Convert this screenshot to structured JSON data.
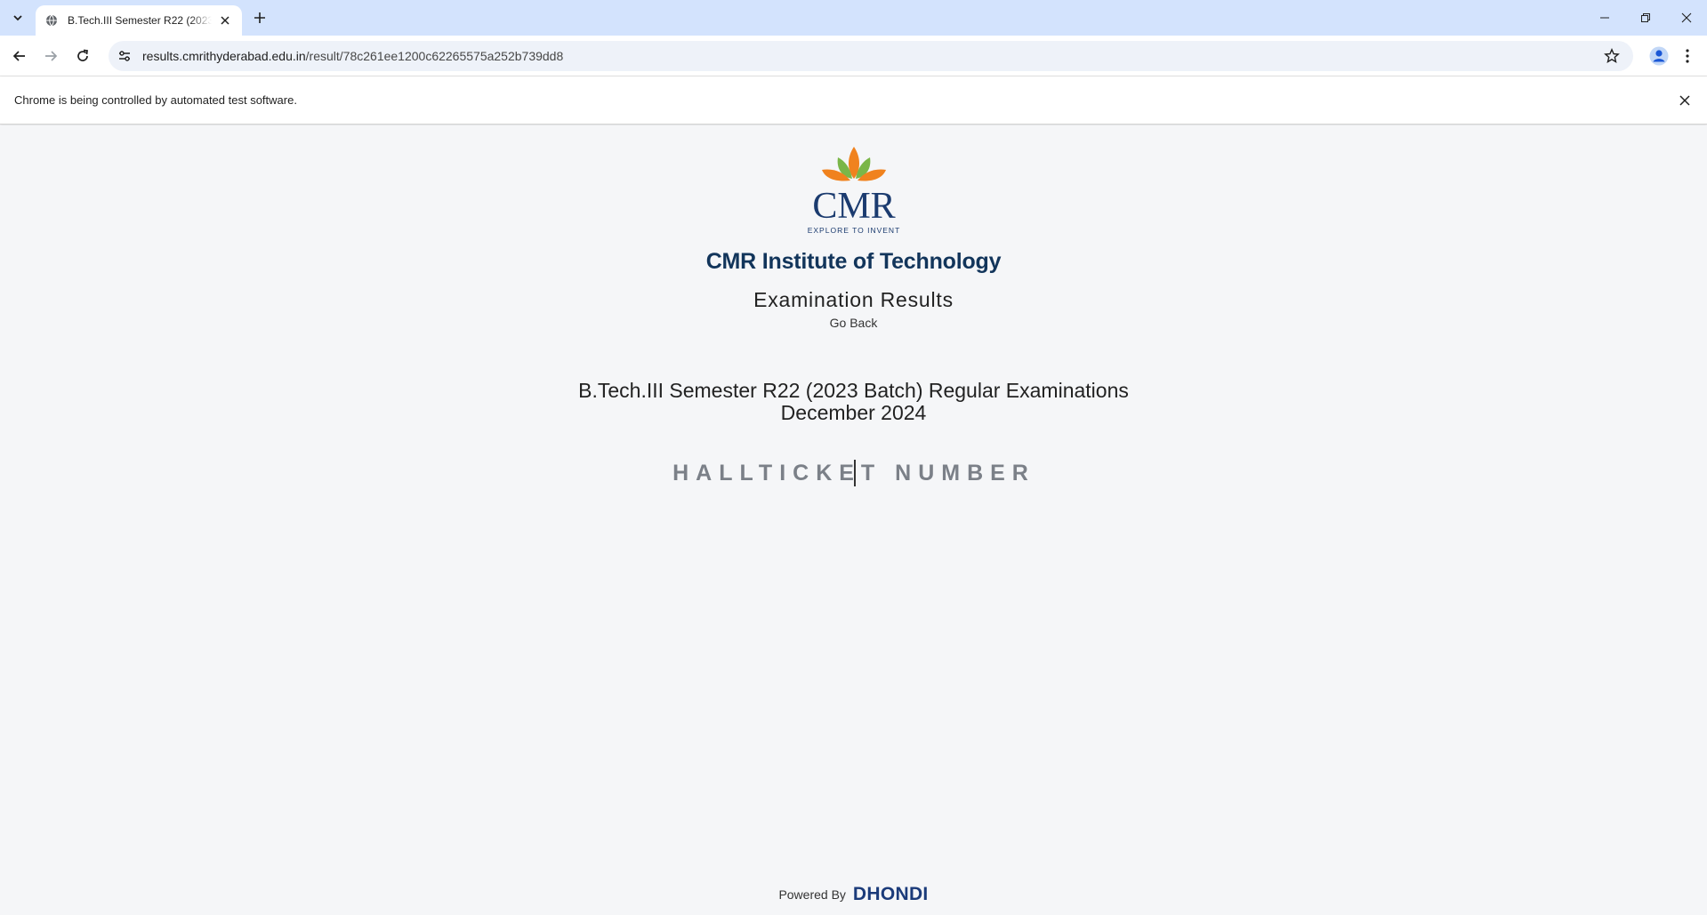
{
  "browser": {
    "tab": {
      "title": "B.Tech.III Semester R22 (2023 B"
    },
    "url": {
      "host": "results.cmrithyderabad.edu.in",
      "path": "/result/78c261ee1200c62265575a252b739dd8"
    },
    "infobar": {
      "message": "Chrome is being controlled by automated test software."
    }
  },
  "page": {
    "logo": {
      "brand": "CMR",
      "tagline": "EXPLORE TO INVENT"
    },
    "institute_name": "CMR Institute of Technology",
    "section_title": "Examination Results",
    "go_back": "Go Back",
    "exam_title_line1": "B.Tech.III Semester R22 (2023 Batch) Regular Examinations",
    "exam_title_line2": "December 2024",
    "hallticket": {
      "placeholder": "HALLTICKET NUMBER",
      "value": ""
    },
    "footer": {
      "powered_by": "Powered By",
      "brand": "DHONDI"
    }
  },
  "colors": {
    "tabstrip": "#d3e3fd",
    "institute": "#12355b",
    "dhondi": "#1b3b7a",
    "logo_orange": "#f0821e",
    "logo_green": "#7ab648"
  }
}
